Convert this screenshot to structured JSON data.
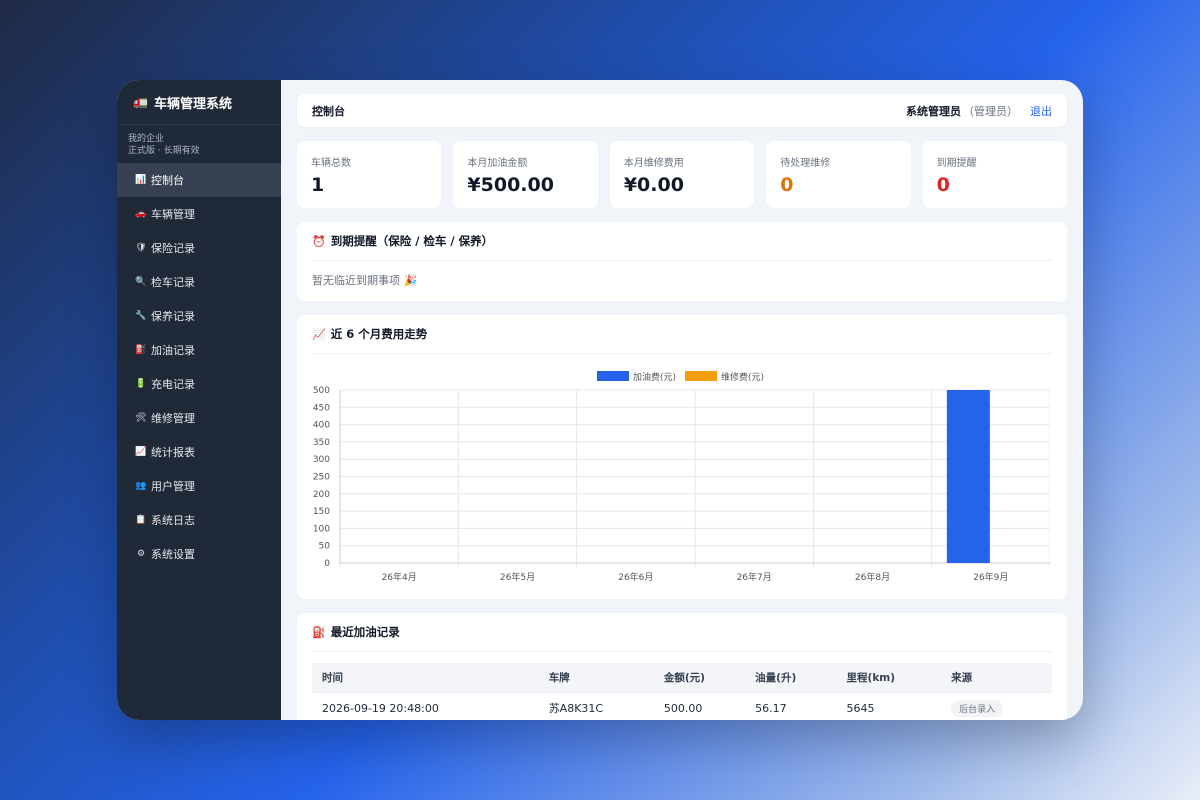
{
  "sidebar": {
    "brand_icon": "🚛",
    "brand_title": "车辆管理系统",
    "org_name": "我的企业",
    "org_plan": "正式版 · 长期有效",
    "items": [
      {
        "icon": "📊",
        "label": "控制台",
        "active": true
      },
      {
        "icon": "🚗",
        "label": "车辆管理"
      },
      {
        "icon": "🛡",
        "label": "保险记录"
      },
      {
        "icon": "🔍",
        "label": "检车记录"
      },
      {
        "icon": "🔧",
        "label": "保养记录"
      },
      {
        "icon": "⛽",
        "label": "加油记录"
      },
      {
        "icon": "🔋",
        "label": "充电记录"
      },
      {
        "icon": "🛠",
        "label": "维修管理"
      },
      {
        "icon": "📈",
        "label": "统计报表"
      },
      {
        "icon": "👥",
        "label": "用户管理"
      },
      {
        "icon": "📋",
        "label": "系统日志"
      },
      {
        "icon": "⚙",
        "label": "系统设置"
      }
    ]
  },
  "topbar": {
    "title": "控制台",
    "admin_name": "系统管理员",
    "admin_role": "（管理员）",
    "logout": "退出"
  },
  "stats": [
    {
      "label": "车辆总数",
      "value": "1",
      "tone": ""
    },
    {
      "label": "本月加油金额",
      "value": "¥500.00",
      "tone": ""
    },
    {
      "label": "本月维修费用",
      "value": "¥0.00",
      "tone": ""
    },
    {
      "label": "待处理维修",
      "value": "0",
      "tone": "orange"
    },
    {
      "label": "到期提醒",
      "value": "0",
      "tone": "red"
    }
  ],
  "reminder": {
    "icon": "⏰",
    "title": "到期提醒（保险 / 检车 / 保养）",
    "empty_text": "暂无临近到期事项 🎉"
  },
  "trend": {
    "icon": "📈",
    "title": "近 6 个月费用走势"
  },
  "chart_data": {
    "type": "bar",
    "categories": [
      "26年4月",
      "26年5月",
      "26年6月",
      "26年7月",
      "26年8月",
      "26年9月"
    ],
    "series": [
      {
        "name": "加油费(元)",
        "values": [
          0,
          0,
          0,
          0,
          0,
          500
        ],
        "color": "#2563eb"
      },
      {
        "name": "维修费(元)",
        "values": [
          0,
          0,
          0,
          0,
          0,
          0
        ],
        "color": "#f59e0b"
      }
    ],
    "ylim": [
      0,
      500
    ],
    "yticks": [
      0,
      50,
      100,
      150,
      200,
      250,
      300,
      350,
      400,
      450,
      500
    ],
    "grid": true,
    "legend": "top-center"
  },
  "fuel": {
    "icon": "⛽",
    "title": "最近加油记录",
    "columns": [
      "时间",
      "车牌",
      "金额(元)",
      "油量(升)",
      "里程(km)",
      "来源"
    ],
    "rows": [
      [
        "2026-09-19 20:48:00",
        "苏A8K31C",
        "500.00",
        "56.17",
        "5645",
        "后台录入"
      ]
    ]
  }
}
